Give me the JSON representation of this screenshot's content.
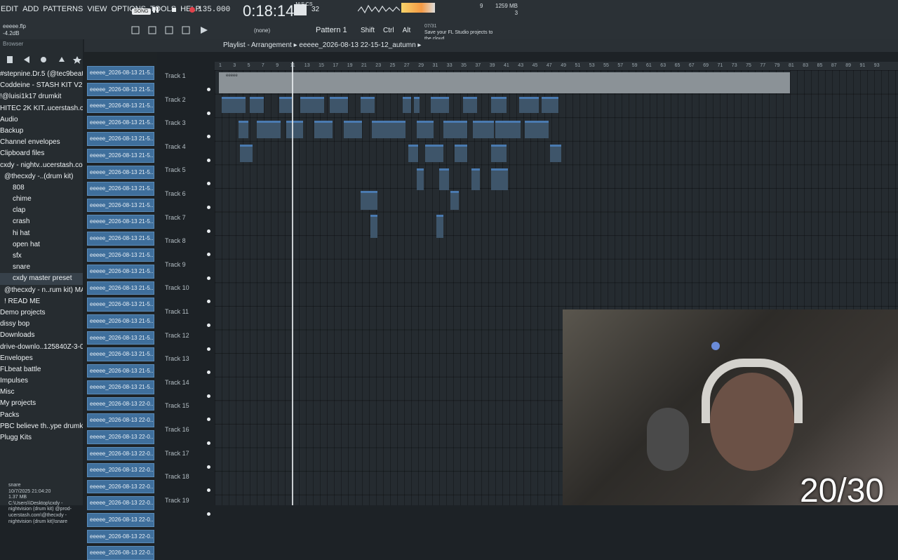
{
  "menu": [
    "EDIT",
    "ADD",
    "PATTERNS",
    "VIEW",
    "OPTIONS",
    "TOOLS",
    "HELP"
  ],
  "song_badge": "SONG",
  "tempo": "135.000",
  "time": {
    "main": "0:18:14",
    "unit": "M:S:CS"
  },
  "time_sig": "32",
  "cpu": "9",
  "memory": {
    "mb": "1259 MB",
    "voices": "3"
  },
  "file": {
    "name": "eeeee.flp",
    "level": "-4.2dB"
  },
  "snap": "(none)",
  "pattern": "Pattern 1",
  "modifiers": [
    "Shift",
    "Ctrl",
    "Alt"
  ],
  "news": {
    "date": "07/31",
    "text": "Save your FL Studio projects to the cloud"
  },
  "browser": {
    "title": "Browser",
    "items": [
      {
        "label": "#stepnine.Dr.5 (@tec9beat)",
        "lvl": 0
      },
      {
        "label": "Coddeine - STASH KIT V2 I",
        "lvl": 0
      },
      {
        "label": "!@luisi1k17 drumkit",
        "lvl": 0
      },
      {
        "label": "HITEC 2K KIT..ucerstash.com",
        "lvl": 0
      },
      {
        "label": "Audio",
        "lvl": 0
      },
      {
        "label": "Backup",
        "lvl": 0
      },
      {
        "label": "Channel envelopes",
        "lvl": 0
      },
      {
        "label": "Clipboard files",
        "lvl": 0
      },
      {
        "label": "cxdy - nightv..ucerstash.com",
        "lvl": 0
      },
      {
        "label": "@thecxdy -..(drum kit)",
        "lvl": 1
      },
      {
        "label": "808",
        "lvl": 2
      },
      {
        "label": "chime",
        "lvl": 2
      },
      {
        "label": "clap",
        "lvl": 2
      },
      {
        "label": "crash",
        "lvl": 2
      },
      {
        "label": "hi hat",
        "lvl": 2
      },
      {
        "label": "open hat",
        "lvl": 2
      },
      {
        "label": "sfx",
        "lvl": 2
      },
      {
        "label": "snare",
        "lvl": 2
      },
      {
        "label": "cxdy master preset",
        "lvl": 2,
        "sel": true
      },
      {
        "label": "@thecxdy - n..rum kit) MAC",
        "lvl": 1
      },
      {
        "label": "! READ ME",
        "lvl": 1
      },
      {
        "label": "Demo projects",
        "lvl": 0
      },
      {
        "label": "dissy bop",
        "lvl": 0
      },
      {
        "label": "Downloads",
        "lvl": 0
      },
      {
        "label": "drive-downlo..125840Z-3-001",
        "lvl": 0
      },
      {
        "label": "Envelopes",
        "lvl": 0
      },
      {
        "label": "FLbeat battle",
        "lvl": 0
      },
      {
        "label": "Impulses",
        "lvl": 0
      },
      {
        "label": "Misc",
        "lvl": 0
      },
      {
        "label": "My projects",
        "lvl": 0
      },
      {
        "label": "Packs",
        "lvl": 0
      },
      {
        "label": "PBC believe th..ype drumkit 1",
        "lvl": 0
      },
      {
        "label": "Plugg Kits",
        "lvl": 0
      }
    ],
    "info": {
      "name": "snare",
      "date": "10/7/2025 21:04:20",
      "size": "1.37 MB",
      "path": "C:\\Users\\\\Desktop\\cxdy - nightvision (drum kit) @prod-ucerstash.com\\@thecxdy - nightvision (drum kit)\\snare"
    }
  },
  "clip_list": [
    "eeeee_2026-08-13 21-5...",
    "eeeee_2026-08-13 21-5...",
    "eeeee_2026-08-13 21-5...",
    "eeeee_2026-08-13 21-5...",
    "eeeee_2026-08-13 21-5...",
    "eeeee_2026-08-13 21-5...",
    "eeeee_2026-08-13 21-5...",
    "eeeee_2026-08-13 21-5...",
    "eeeee_2026-08-13 21-5...",
    "eeeee_2026-08-13 21-5...",
    "eeeee_2026-08-13 21-5...",
    "eeeee_2026-08-13 21-5...",
    "eeeee_2026-08-13 21-5...",
    "eeeee_2026-08-13 21-5...",
    "eeeee_2026-08-13 21-5...",
    "eeeee_2026-08-13 21-5...",
    "eeeee_2026-08-13 21-5...",
    "eeeee_2026-08-13 21-5...",
    "eeeee_2026-08-13 21-5...",
    "eeeee_2026-08-13 21-5...",
    "eeeee_2026-08-13 22-0...",
    "eeeee_2026-08-13 22-0...",
    "eeeee_2026-08-13 22-0...",
    "eeeee_2026-08-13 22-0...",
    "eeeee_2026-08-13 22-0...",
    "eeeee_2026-08-13 22-0...",
    "eeeee_2026-08-13 22-0...",
    "eeeee_2026-08-13 22-0...",
    "eeeee_2026-08-13 22-0...",
    "eeeee_2026-08-13 22-0..."
  ],
  "playlist": {
    "title": "Playlist - Arrangement",
    "arrangement": "eeeee_2026-08-13 22-15-12_autumn",
    "ruler": [
      "1",
      "3",
      "5",
      "7",
      "9",
      "11",
      "13",
      "15",
      "17",
      "19",
      "21",
      "23",
      "25",
      "27",
      "29",
      "31",
      "33",
      "35",
      "37",
      "39",
      "41",
      "43",
      "45",
      "47",
      "49",
      "51",
      "53",
      "55",
      "57",
      "59",
      "61",
      "63",
      "65",
      "67",
      "69",
      "71",
      "73",
      "75",
      "77",
      "79",
      "81",
      "83",
      "85",
      "87",
      "89",
      "91",
      "93"
    ],
    "tracks": [
      "Track 1",
      "Track 2",
      "Track 3",
      "Track 4",
      "Track 5",
      "Track 6",
      "Track 7",
      "Track 8",
      "Track 9",
      "Track 10",
      "Track 11",
      "Track 12",
      "Track 13",
      "Track 14",
      "Track 15",
      "Track 16",
      "Track 17",
      "Track 18",
      "Track 19"
    ],
    "audio_clip_label": "eeeee"
  },
  "overlay_counter": "20/30"
}
